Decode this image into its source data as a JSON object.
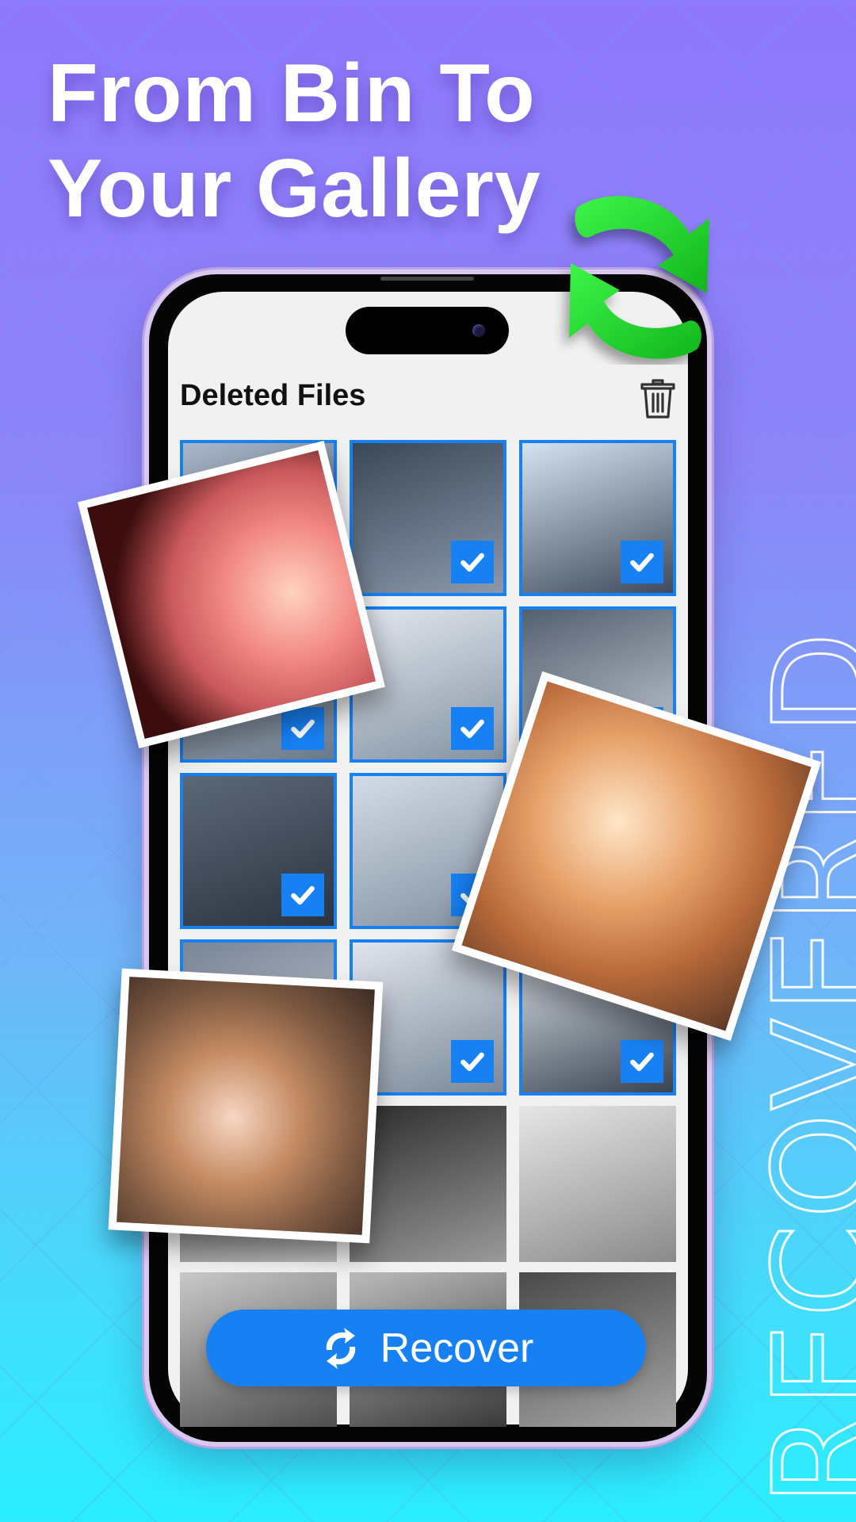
{
  "headline": {
    "line1": "From Bin To",
    "line2": "Your Gallery"
  },
  "side_text": "RECOVERED",
  "app": {
    "title": "Deleted Files",
    "trash_icon": "trash-icon",
    "recover_label": "Recover",
    "recover_icon": "sync-icon"
  },
  "colors": {
    "accent": "#1781f3",
    "arrow_green": "#22d42c",
    "bg_top": "#8f78fb",
    "bg_bottom": "#29eefd"
  },
  "grid": {
    "columns": 3,
    "tiles": [
      {
        "label": "photo-man-cap",
        "selected": true
      },
      {
        "label": "photo-couple-scarf",
        "selected": true
      },
      {
        "label": "photo-couple-hat",
        "selected": true
      },
      {
        "label": "photo-child",
        "selected": true
      },
      {
        "label": "photo-cartoon-girl",
        "selected": true
      },
      {
        "label": "photo-couple-smiling",
        "selected": true
      },
      {
        "label": "photo-girl-hand-head",
        "selected": true
      },
      {
        "label": "photo-girl-hands-cheeks",
        "selected": true
      },
      {
        "label": "photo-hidden",
        "selected": true
      },
      {
        "label": "photo-girl-smile",
        "selected": true
      },
      {
        "label": "photo-girl-braids",
        "selected": true
      },
      {
        "label": "photo-woman-smile",
        "selected": true
      },
      {
        "label": "photo-boy-hug",
        "selected": false
      },
      {
        "label": "photo-woman-long-hair",
        "selected": false
      },
      {
        "label": "photo-girl-portrait",
        "selected": false
      },
      {
        "label": "photo-girl-hair-clip",
        "selected": false
      },
      {
        "label": "photo-family",
        "selected": false
      },
      {
        "label": "photo-woman-back",
        "selected": false
      }
    ]
  },
  "recovered_photos": [
    {
      "label": "recovered-sunset-silhouette"
    },
    {
      "label": "recovered-family-baby"
    },
    {
      "label": "recovered-kids-hugging"
    }
  ]
}
